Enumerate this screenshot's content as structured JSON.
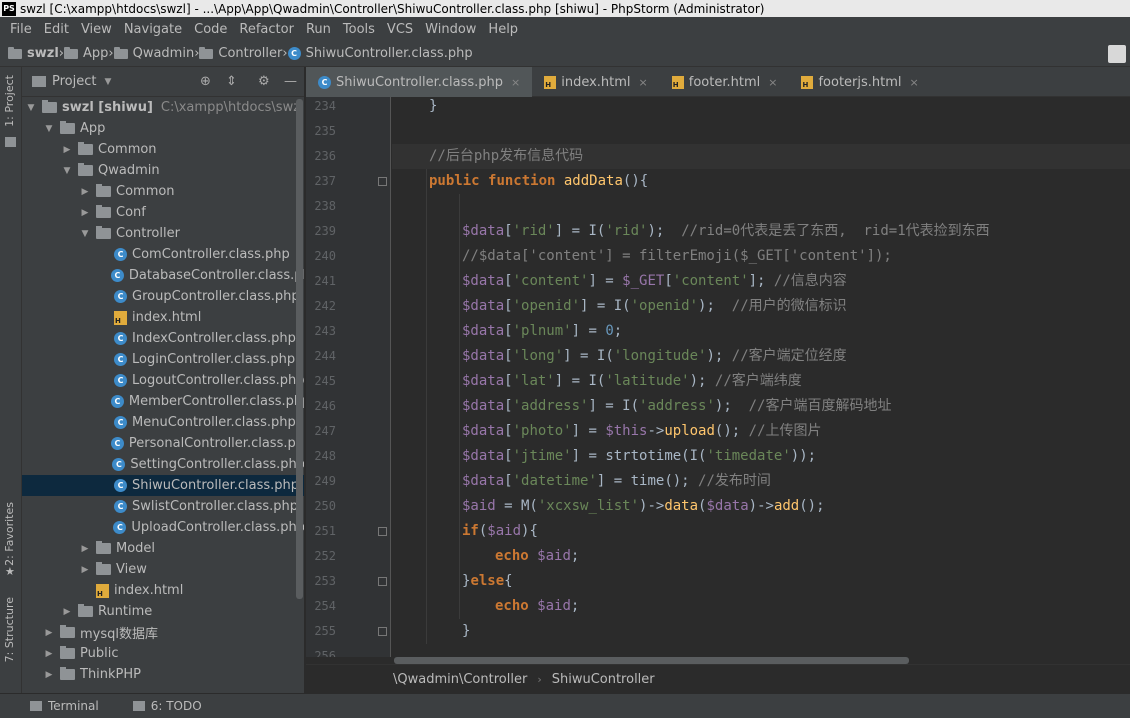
{
  "window": {
    "title": "swzl [C:\\xampp\\htdocs\\swzl] - ...\\App\\App\\Qwadmin\\Controller\\ShiwuController.class.php [shiwu] - PhpStorm (Administrator)",
    "logo_text": "PS"
  },
  "menu": [
    "File",
    "Edit",
    "View",
    "Navigate",
    "Code",
    "Refactor",
    "Run",
    "Tools",
    "VCS",
    "Window",
    "Help"
  ],
  "navbar": {
    "crumbs": [
      "swzl",
      "App",
      "Qwadmin",
      "Controller",
      "ShiwuController.class.php"
    ]
  },
  "left_stripe": {
    "project_tab": "1: Project",
    "favorites_tab": "2: Favorites",
    "structure_tab": "7: Structure"
  },
  "project_panel": {
    "title": "Project",
    "tree": [
      {
        "depth": 0,
        "arrow": "open",
        "icon": "folder",
        "label": "swzl [shiwu]",
        "extra": "C:\\xampp\\htdocs\\swzl"
      },
      {
        "depth": 1,
        "arrow": "open",
        "icon": "folder",
        "label": "App"
      },
      {
        "depth": 2,
        "arrow": "closed",
        "icon": "folder",
        "label": "Common"
      },
      {
        "depth": 2,
        "arrow": "open",
        "icon": "folder",
        "label": "Qwadmin"
      },
      {
        "depth": 3,
        "arrow": "closed",
        "icon": "folder",
        "label": "Common"
      },
      {
        "depth": 3,
        "arrow": "closed",
        "icon": "folder",
        "label": "Conf"
      },
      {
        "depth": 3,
        "arrow": "open",
        "icon": "folder",
        "label": "Controller"
      },
      {
        "depth": 4,
        "arrow": "none",
        "icon": "class",
        "label": "ComController.class.php"
      },
      {
        "depth": 4,
        "arrow": "none",
        "icon": "class",
        "label": "DatabaseController.class.php"
      },
      {
        "depth": 4,
        "arrow": "none",
        "icon": "class",
        "label": "GroupController.class.php"
      },
      {
        "depth": 4,
        "arrow": "none",
        "icon": "html",
        "label": "index.html"
      },
      {
        "depth": 4,
        "arrow": "none",
        "icon": "class",
        "label": "IndexController.class.php"
      },
      {
        "depth": 4,
        "arrow": "none",
        "icon": "class",
        "label": "LoginController.class.php"
      },
      {
        "depth": 4,
        "arrow": "none",
        "icon": "class",
        "label": "LogoutController.class.php"
      },
      {
        "depth": 4,
        "arrow": "none",
        "icon": "class",
        "label": "MemberController.class.php"
      },
      {
        "depth": 4,
        "arrow": "none",
        "icon": "class",
        "label": "MenuController.class.php"
      },
      {
        "depth": 4,
        "arrow": "none",
        "icon": "class",
        "label": "PersonalController.class.php"
      },
      {
        "depth": 4,
        "arrow": "none",
        "icon": "class",
        "label": "SettingController.class.php"
      },
      {
        "depth": 4,
        "arrow": "none",
        "icon": "class",
        "label": "ShiwuController.class.php",
        "selected": true
      },
      {
        "depth": 4,
        "arrow": "none",
        "icon": "class",
        "label": "SwlistController.class.php"
      },
      {
        "depth": 4,
        "arrow": "none",
        "icon": "class",
        "label": "UploadController.class.php"
      },
      {
        "depth": 3,
        "arrow": "closed",
        "icon": "folder",
        "label": "Model"
      },
      {
        "depth": 3,
        "arrow": "closed",
        "icon": "folder",
        "label": "View"
      },
      {
        "depth": 3,
        "arrow": "none",
        "icon": "html",
        "label": "index.html"
      },
      {
        "depth": 2,
        "arrow": "closed",
        "icon": "folder",
        "label": "Runtime"
      },
      {
        "depth": 1,
        "arrow": "closed",
        "icon": "folder",
        "label": "mysql数据库"
      },
      {
        "depth": 1,
        "arrow": "closed",
        "icon": "folder",
        "label": "Public"
      },
      {
        "depth": 1,
        "arrow": "closed",
        "icon": "folder",
        "label": "ThinkPHP"
      }
    ]
  },
  "tabs": [
    {
      "label": "ShiwuController.class.php",
      "icon": "class",
      "active": true
    },
    {
      "label": "index.html",
      "icon": "html"
    },
    {
      "label": "footer.html",
      "icon": "html"
    },
    {
      "label": "footerjs.html",
      "icon": "html"
    }
  ],
  "editor": {
    "lines": [
      {
        "n": "234",
        "indent": 1,
        "tokens": [
          [
            "plain",
            "}"
          ]
        ]
      },
      {
        "n": "235",
        "indent": 0,
        "tokens": []
      },
      {
        "n": "236",
        "indent": 1,
        "tokens": [
          [
            "cm",
            "//后台php发布信息代码"
          ]
        ],
        "current": true
      },
      {
        "n": "237",
        "indent": 1,
        "tokens": [
          [
            "kw",
            "public "
          ],
          [
            "kw",
            "function "
          ],
          [
            "fn",
            "addData"
          ],
          [
            "plain",
            "(){"
          ]
        ],
        "fold": true
      },
      {
        "n": "238",
        "indent": 0,
        "tokens": []
      },
      {
        "n": "239",
        "indent": 2,
        "tokens": [
          [
            "var",
            "$data"
          ],
          [
            "plain",
            "["
          ],
          [
            "str",
            "'rid'"
          ],
          [
            "plain",
            "] = I("
          ],
          [
            "str",
            "'rid'"
          ],
          [
            "plain",
            ");  "
          ],
          [
            "cm",
            "//rid=0代表是丢了东西,  rid=1代表捡到东西"
          ]
        ]
      },
      {
        "n": "240",
        "indent": 2,
        "tokens": [
          [
            "cm",
            "//$data['content'] = filterEmoji($_GET['content']);"
          ]
        ]
      },
      {
        "n": "241",
        "indent": 2,
        "tokens": [
          [
            "var",
            "$data"
          ],
          [
            "plain",
            "["
          ],
          [
            "str",
            "'content'"
          ],
          [
            "plain",
            "] = "
          ],
          [
            "var",
            "$_GET"
          ],
          [
            "plain",
            "["
          ],
          [
            "str",
            "'content'"
          ],
          [
            "plain",
            "]; "
          ],
          [
            "cm",
            "//信息内容"
          ]
        ]
      },
      {
        "n": "242",
        "indent": 2,
        "tokens": [
          [
            "var",
            "$data"
          ],
          [
            "plain",
            "["
          ],
          [
            "str",
            "'openid'"
          ],
          [
            "plain",
            "] = I("
          ],
          [
            "str",
            "'openid'"
          ],
          [
            "plain",
            ");  "
          ],
          [
            "cm",
            "//用户的微信标识"
          ]
        ]
      },
      {
        "n": "243",
        "indent": 2,
        "tokens": [
          [
            "var",
            "$data"
          ],
          [
            "plain",
            "["
          ],
          [
            "str",
            "'plnum'"
          ],
          [
            "plain",
            "] = "
          ],
          [
            "num",
            "0"
          ],
          [
            "plain",
            ";"
          ]
        ]
      },
      {
        "n": "244",
        "indent": 2,
        "tokens": [
          [
            "var",
            "$data"
          ],
          [
            "plain",
            "["
          ],
          [
            "str",
            "'long'"
          ],
          [
            "plain",
            "] = I("
          ],
          [
            "str",
            "'longitude'"
          ],
          [
            "plain",
            "); "
          ],
          [
            "cm",
            "//客户端定位经度"
          ]
        ]
      },
      {
        "n": "245",
        "indent": 2,
        "tokens": [
          [
            "var",
            "$data"
          ],
          [
            "plain",
            "["
          ],
          [
            "str",
            "'lat'"
          ],
          [
            "plain",
            "] = I("
          ],
          [
            "str",
            "'latitude'"
          ],
          [
            "plain",
            "); "
          ],
          [
            "cm",
            "//客户端纬度"
          ]
        ]
      },
      {
        "n": "246",
        "indent": 2,
        "tokens": [
          [
            "var",
            "$data"
          ],
          [
            "plain",
            "["
          ],
          [
            "str",
            "'address'"
          ],
          [
            "plain",
            "] = I("
          ],
          [
            "str",
            "'address'"
          ],
          [
            "plain",
            ");  "
          ],
          [
            "cm",
            "//客户端百度解码地址"
          ]
        ]
      },
      {
        "n": "247",
        "indent": 2,
        "tokens": [
          [
            "var",
            "$data"
          ],
          [
            "plain",
            "["
          ],
          [
            "str",
            "'photo'"
          ],
          [
            "plain",
            "] = "
          ],
          [
            "var",
            "$this"
          ],
          [
            "plain",
            "->"
          ],
          [
            "fn",
            "upload"
          ],
          [
            "plain",
            "(); "
          ],
          [
            "cm",
            "//上传图片"
          ]
        ]
      },
      {
        "n": "248",
        "indent": 2,
        "tokens": [
          [
            "var",
            "$data"
          ],
          [
            "plain",
            "["
          ],
          [
            "str",
            "'jtime'"
          ],
          [
            "plain",
            "] = strtotime(I("
          ],
          [
            "str",
            "'timedate'"
          ],
          [
            "plain",
            "));"
          ]
        ]
      },
      {
        "n": "249",
        "indent": 2,
        "tokens": [
          [
            "var",
            "$data"
          ],
          [
            "plain",
            "["
          ],
          [
            "str",
            "'datetime'"
          ],
          [
            "plain",
            "] = time(); "
          ],
          [
            "cm",
            "//发布时间"
          ]
        ]
      },
      {
        "n": "250",
        "indent": 2,
        "tokens": [
          [
            "var",
            "$aid"
          ],
          [
            "plain",
            " = M("
          ],
          [
            "str",
            "'xcxsw_list'"
          ],
          [
            "plain",
            ")->"
          ],
          [
            "fn",
            "data"
          ],
          [
            "plain",
            "("
          ],
          [
            "var",
            "$data"
          ],
          [
            "plain",
            ")->"
          ],
          [
            "fn",
            "add"
          ],
          [
            "plain",
            "();"
          ]
        ]
      },
      {
        "n": "251",
        "indent": 2,
        "tokens": [
          [
            "kw",
            "if"
          ],
          [
            "plain",
            "("
          ],
          [
            "var",
            "$aid"
          ],
          [
            "plain",
            "){"
          ]
        ],
        "fold": true
      },
      {
        "n": "252",
        "indent": 3,
        "tokens": [
          [
            "kw",
            "echo "
          ],
          [
            "var",
            "$aid"
          ],
          [
            "plain",
            ";"
          ]
        ]
      },
      {
        "n": "253",
        "indent": 2,
        "tokens": [
          [
            "plain",
            "}"
          ],
          [
            "kw",
            "else"
          ],
          [
            "plain",
            "{"
          ]
        ],
        "fold": true
      },
      {
        "n": "254",
        "indent": 3,
        "tokens": [
          [
            "kw",
            "echo "
          ],
          [
            "var",
            "$aid"
          ],
          [
            "plain",
            ";"
          ]
        ]
      },
      {
        "n": "255",
        "indent": 2,
        "tokens": [
          [
            "plain",
            "}"
          ]
        ],
        "fold": true
      },
      {
        "n": "256",
        "indent": 0,
        "tokens": []
      }
    ]
  },
  "breadcrumb_bar": [
    "\\Qwadmin\\Controller",
    "ShiwuController"
  ],
  "bottom_bar": [
    "Terminal",
    "6: TODO"
  ]
}
